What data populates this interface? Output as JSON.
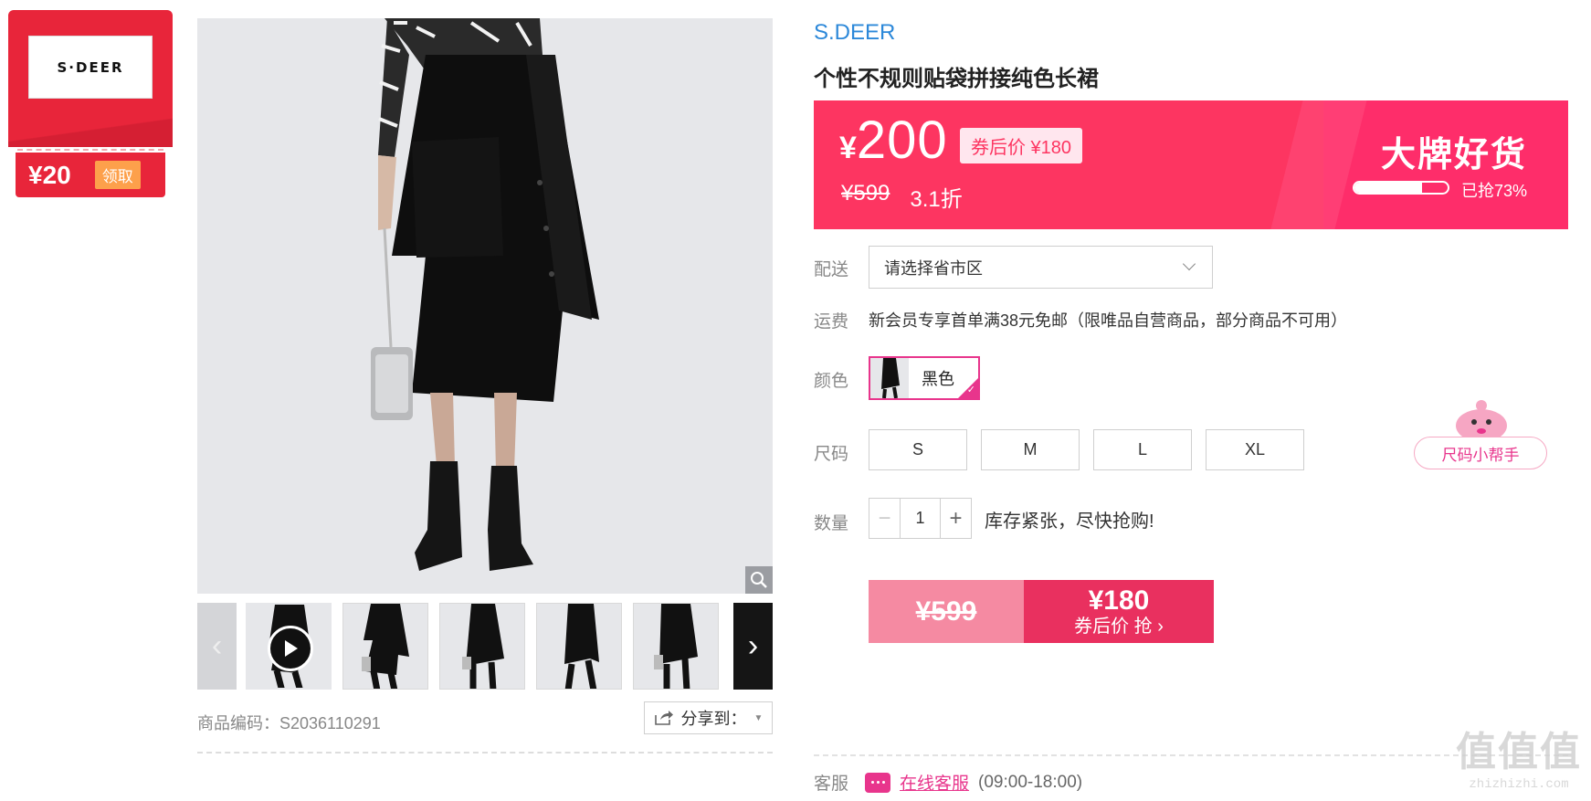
{
  "brand_coupon": {
    "logo_text": "S·DEER",
    "amount": "¥20",
    "claim_label": "领取"
  },
  "gallery": {
    "zoom_icon": "magnifier-icon",
    "thumb_count": 5,
    "prev_glyph": "‹",
    "next_glyph": "›",
    "sku_text": "商品编码：S2036110291",
    "share_label": "分享到："
  },
  "product": {
    "brand": "S.DEER",
    "title": "个性不规则贴袋拼接纯色长裙"
  },
  "price_banner": {
    "currency": "¥",
    "price": "200",
    "coupon_price": "券后价 ¥180",
    "original_price": "¥599",
    "discount": "3.1折",
    "promo_title": "大牌好货",
    "sold_progress": 0.73,
    "sold_text": "已抢73%"
  },
  "delivery": {
    "label": "配送",
    "select_value": "请选择省市区"
  },
  "shipping": {
    "label": "运费",
    "text": "新会员专享首单满38元免邮（限唯品自营商品，部分商品不可用）"
  },
  "color": {
    "label": "颜色",
    "options": [
      {
        "label": "黑色",
        "selected": true
      }
    ]
  },
  "size": {
    "label": "尺码",
    "options": [
      "S",
      "M",
      "L",
      "XL"
    ],
    "helper_label": "尺码小帮手"
  },
  "quantity": {
    "label": "数量",
    "minus": "−",
    "value": "1",
    "plus": "+",
    "stock_note": "库存紧张，尽快抢购!"
  },
  "buy_button": {
    "original_price": "¥599",
    "price": "¥180",
    "action": "券后价 抢 ›"
  },
  "service": {
    "label": "客服",
    "link": "在线客服",
    "hours": "(09:00-18:00)"
  },
  "watermark": {
    "big": "值值值",
    "small": "zhizhizhi.com"
  },
  "colors": {
    "accent_pink": "#fd3561",
    "brand_red": "#e8253a",
    "link_blue": "#2c88d9",
    "magenta": "#e8358c"
  }
}
